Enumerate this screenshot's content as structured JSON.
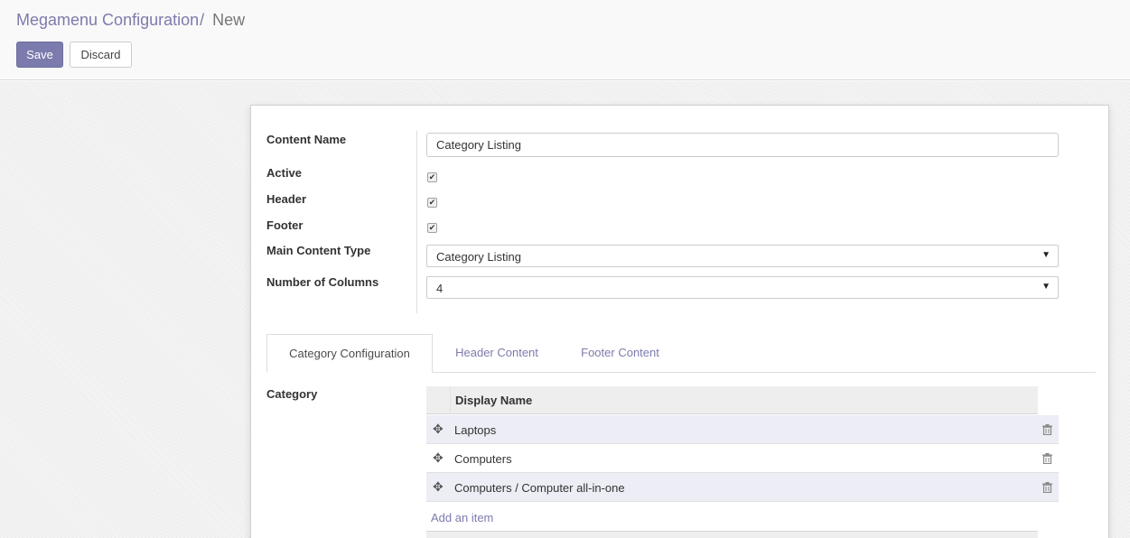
{
  "breadcrumb": {
    "parent": "Megamenu Configuration",
    "separator": "/",
    "current": "New"
  },
  "buttons": {
    "save": "Save",
    "discard": "Discard"
  },
  "form": {
    "content_name_label": "Content Name",
    "content_name_value": "Category Listing",
    "active_label": "Active",
    "active_checked": true,
    "header_label": "Header",
    "header_checked": true,
    "footer_label": "Footer",
    "footer_checked": true,
    "main_content_type_label": "Main Content Type",
    "main_content_type_value": "Category Listing",
    "number_of_columns_label": "Number of Columns",
    "number_of_columns_value": "4",
    "check_glyph": "✔"
  },
  "tabs": [
    {
      "label": "Category Configuration",
      "active": true
    },
    {
      "label": "Header Content",
      "active": false
    },
    {
      "label": "Footer Content",
      "active": false
    }
  ],
  "category": {
    "label": "Category",
    "column_header": "Display Name",
    "rows": [
      {
        "display_name": "Laptops"
      },
      {
        "display_name": "Computers"
      },
      {
        "display_name": "Computers / Computer all-in-one"
      }
    ],
    "add_item": "Add an item"
  },
  "icons": {
    "drag": "drag-handle-icon",
    "delete": "trash-icon",
    "dropdown": "caret-down-icon"
  },
  "colors": {
    "accent": "#7c7bad",
    "row_highlight": "#ecedf5"
  }
}
